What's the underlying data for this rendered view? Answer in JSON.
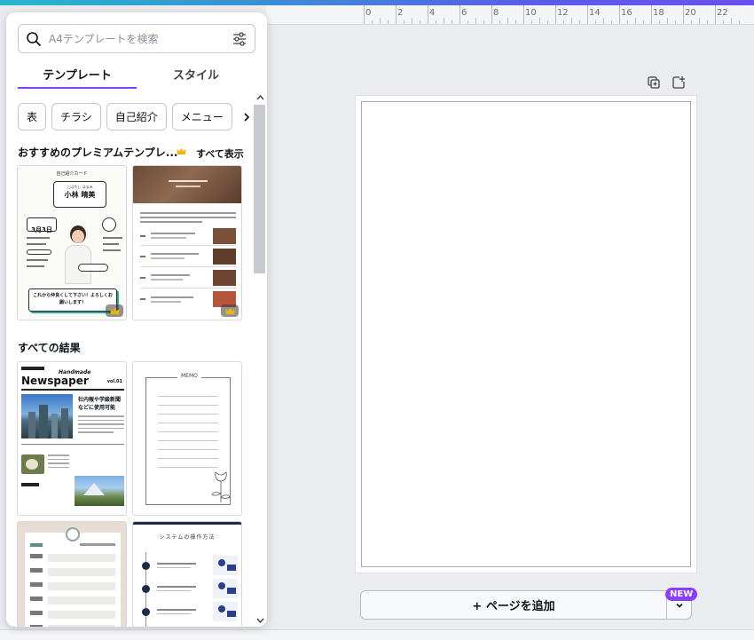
{
  "ruler": {
    "ticks": [
      "0",
      "2",
      "4",
      "6",
      "8",
      "10",
      "12",
      "14",
      "16",
      "18",
      "20",
      "22"
    ]
  },
  "search": {
    "placeholder": "A4テンプレートを検索"
  },
  "tabs": [
    {
      "label": "テンプレート",
      "active": true
    },
    {
      "label": "スタイル",
      "active": false
    }
  ],
  "chips": [
    "表",
    "チラシ",
    "自己紹介",
    "メニュー"
  ],
  "sections": {
    "premium_title": "おすすめのプレミアムテンプレ...",
    "show_all": "すべて表示",
    "results_title": "すべての結果"
  },
  "thumbnails": {
    "intro": {
      "header": "自己紹介カード",
      "name": "小林 晴美",
      "name_kana": "こばやし はるみ",
      "date": "3月3日",
      "footer": "これから仲良くして下さい！よろしくお願いします！"
    },
    "newspaper": {
      "title": "Newspaper",
      "script": "Handmade",
      "vol": "vol.01",
      "headline": "社内報や学級新聞などに使用可能"
    },
    "memo": {
      "title": "MEMO"
    },
    "system": {
      "title": "システムの操作方法"
    }
  },
  "add_page": {
    "label": "+ ページを追加",
    "badge": "NEW"
  },
  "colors": {
    "accent": "#8b3dff",
    "crown": "#f4b400"
  }
}
